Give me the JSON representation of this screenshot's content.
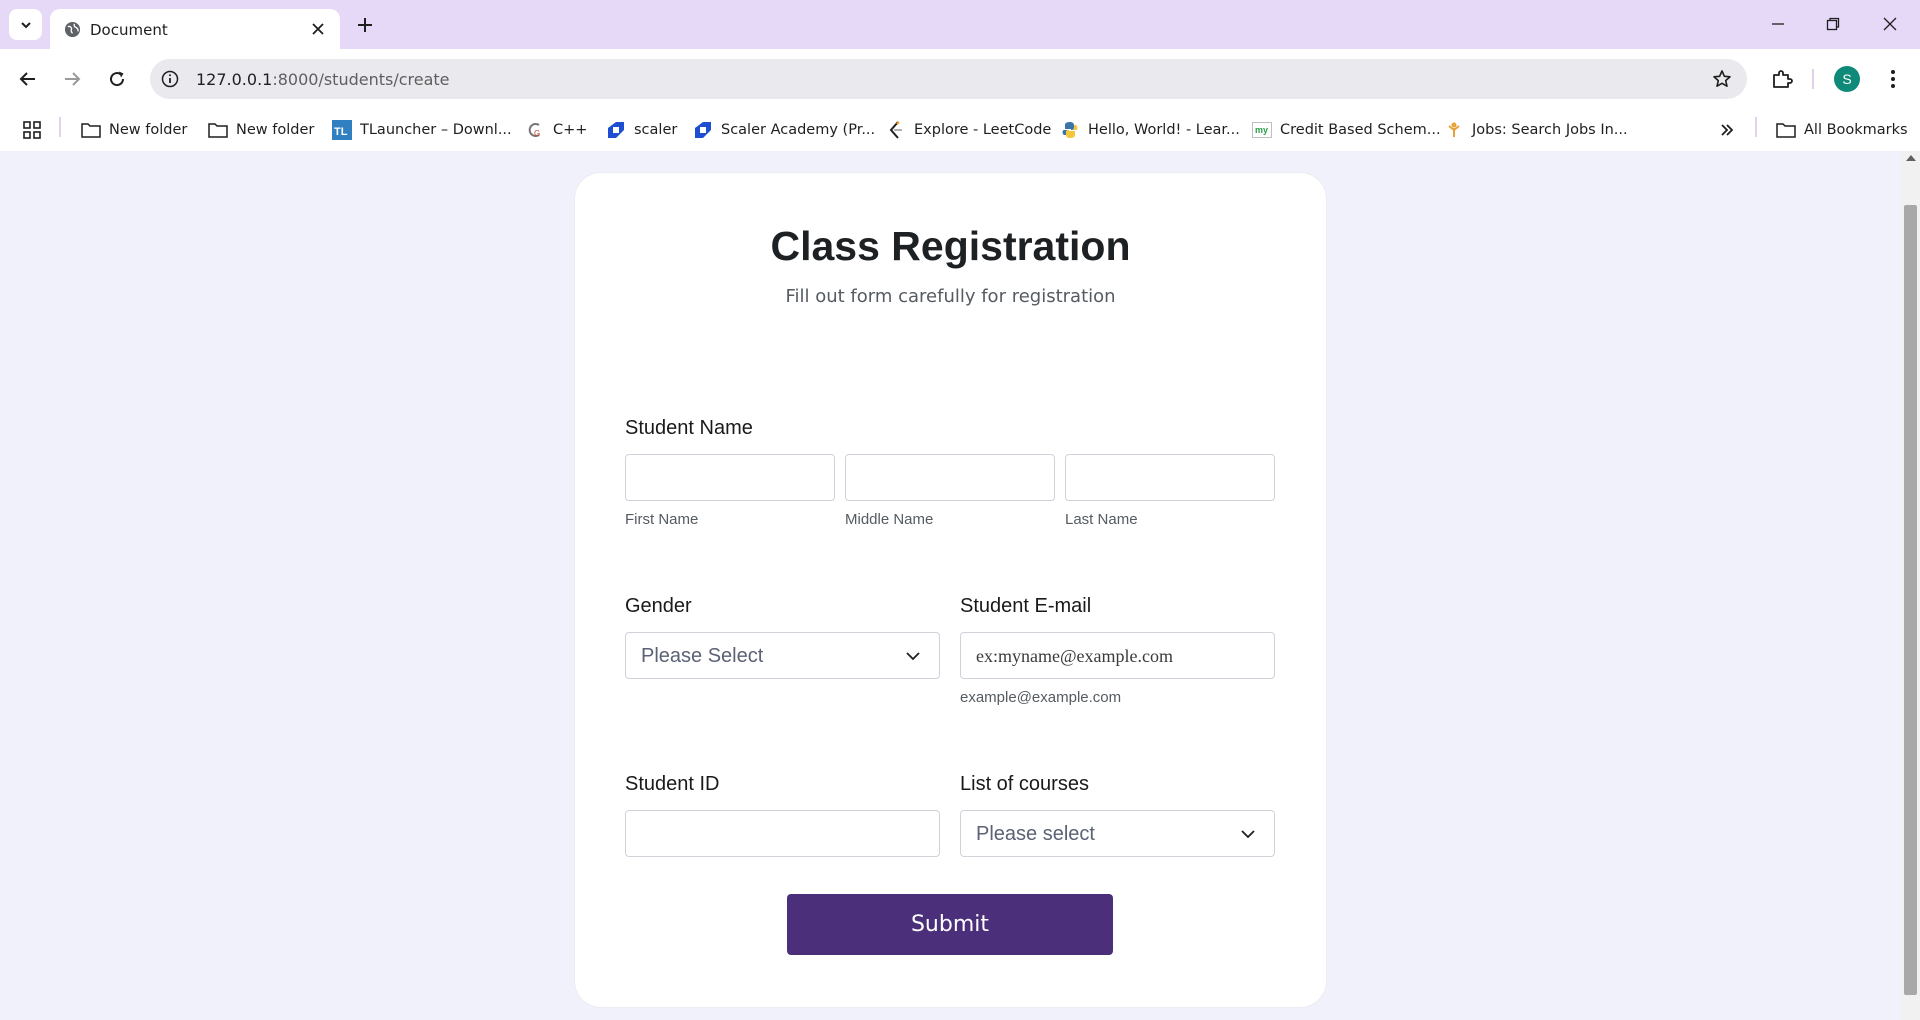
{
  "browser": {
    "tab_title": "Document",
    "url_host": "127.0.0.1",
    "url_rest": ":8000/students/create",
    "profile_initial": "S",
    "bookmarks": [
      {
        "label": "New folder",
        "icon": "folder-icon"
      },
      {
        "label": "New folder",
        "icon": "folder-icon"
      },
      {
        "label": "TLauncher – Downl...",
        "icon": "tlauncher-icon"
      },
      {
        "label": "C++",
        "icon": "cpp-icon"
      },
      {
        "label": "scaler",
        "icon": "scaler-icon"
      },
      {
        "label": "Scaler Academy (Pr...",
        "icon": "scaler-icon"
      },
      {
        "label": "Explore - LeetCode",
        "icon": "leetcode-icon"
      },
      {
        "label": "Hello, World! - Lear...",
        "icon": "python-icon"
      },
      {
        "label": "Credit Based Schem...",
        "icon": "my-icon"
      },
      {
        "label": "Jobs: Search Jobs In...",
        "icon": "jobs-icon"
      }
    ],
    "all_bookmarks": "All Bookmarks"
  },
  "form": {
    "title": "Class Registration",
    "subtitle": "Fill out form carefully for registration",
    "student_name_label": "Student Name",
    "first_name_label": "First Name",
    "middle_name_label": "Middle Name",
    "last_name_label": "Last Name",
    "gender_label": "Gender",
    "gender_value": "Please Select",
    "email_label": "Student E-mail",
    "email_placeholder": "ex:myname@example.com",
    "email_hint": "example@example.com",
    "student_id_label": "Student ID",
    "courses_label": "List of courses",
    "courses_value": "Please select",
    "submit_label": "Submit"
  },
  "colors": {
    "tabstrip": "#e6d9f7",
    "page_bg": "#f1f1fb",
    "submit_bg": "#4b2f7a",
    "avatar": "#0f8a78"
  }
}
